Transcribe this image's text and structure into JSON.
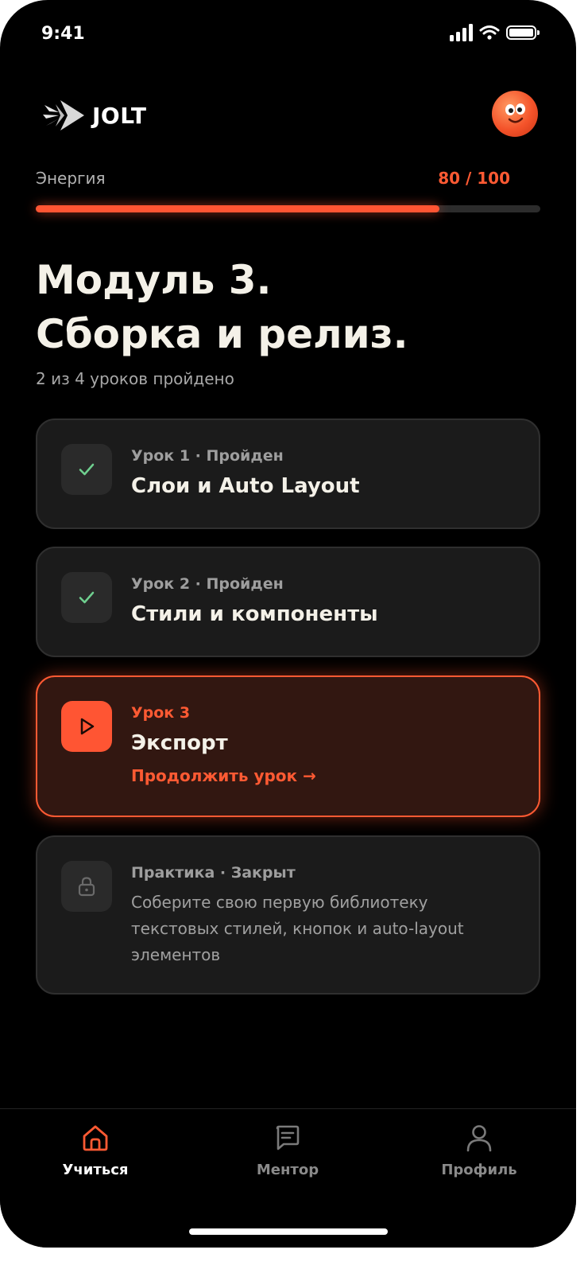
{
  "status_bar": {
    "time": "9:41"
  },
  "app": {
    "logo_text": "JOLT"
  },
  "energy": {
    "label": "Энергия",
    "value_text": "80 / 100",
    "current": 80,
    "max": 100
  },
  "module": {
    "title_line1": "Модуль 3.",
    "title_line2": "Сборка и релиз.",
    "progress_text": "2 из 4 уроков пройдено"
  },
  "lessons": [
    {
      "meta": "Урок 1 · Пройден",
      "title": "Слои и Auto Layout",
      "state": "completed",
      "icon": "check-icon"
    },
    {
      "meta": "Урок 2 · Пройден",
      "title": "Стили и компоненты",
      "state": "completed",
      "icon": "check-icon"
    },
    {
      "meta": "Урок 3",
      "title": "Экспорт",
      "cta": "Продолжить урок →",
      "state": "active",
      "icon": "play-icon"
    },
    {
      "meta": "Практика · Закрыт",
      "description": "Соберите свою первую библиотеку текстовых стилей, кнопок и auto-layout элементов",
      "state": "locked",
      "icon": "lock-icon"
    }
  ],
  "tabs": [
    {
      "label": "Учиться",
      "icon": "home-icon",
      "active": true
    },
    {
      "label": "Ментор",
      "icon": "chat-icon",
      "active": false
    },
    {
      "label": "Профиль",
      "icon": "user-icon",
      "active": false
    }
  ],
  "colors": {
    "accent": "#ff5533",
    "background": "#000000",
    "card": "#1b1b1b",
    "active_card": "#321711",
    "check": "#6fcf8f"
  }
}
